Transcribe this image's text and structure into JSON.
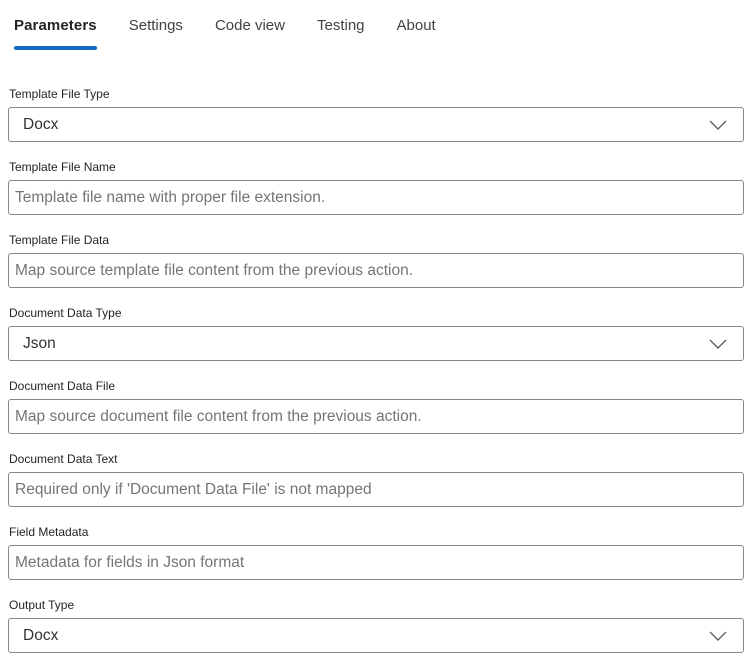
{
  "tabs": {
    "items": [
      {
        "label": "Parameters",
        "active": true
      },
      {
        "label": "Settings",
        "active": false
      },
      {
        "label": "Code view",
        "active": false
      },
      {
        "label": "Testing",
        "active": false
      },
      {
        "label": "About",
        "active": false
      }
    ]
  },
  "fields": [
    {
      "type": "dropdown",
      "label": "Template File Type",
      "value": "Docx"
    },
    {
      "type": "text",
      "label": "Template File Name",
      "placeholder": "Template file name with proper file extension."
    },
    {
      "type": "text",
      "label": "Template File Data",
      "placeholder": "Map source template file content from the previous action."
    },
    {
      "type": "dropdown",
      "label": "Document Data Type",
      "value": "Json"
    },
    {
      "type": "text",
      "label": "Document Data File",
      "placeholder": "Map source document file content from the previous action."
    },
    {
      "type": "text",
      "label": "Document Data Text",
      "placeholder": "Required only if 'Document Data File' is not mapped"
    },
    {
      "type": "text",
      "label": "Field Metadata",
      "placeholder": "Metadata for fields in Json format"
    },
    {
      "type": "dropdown",
      "label": "Output Type",
      "value": "Docx"
    }
  ],
  "icons": {
    "dropdown_chevron": "chevron-down-icon"
  },
  "colors": {
    "accent": "#0f6cbd",
    "border": "#8a8886",
    "label": "#242424",
    "value": "#323130",
    "placeholder": "#757575",
    "tab_inactive": "#424242"
  }
}
